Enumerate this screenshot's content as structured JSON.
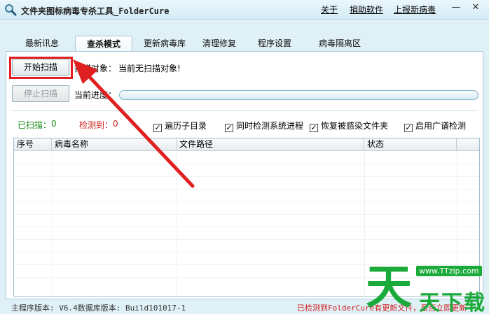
{
  "window": {
    "title": "文件夹图标病毒专杀工具_FolderCure",
    "links": [
      "关于",
      "捐助软件",
      "上报新病毒"
    ],
    "controls": {
      "minimize": "—",
      "close": "✕"
    }
  },
  "tabs": [
    {
      "label": "最新讯息",
      "active": false
    },
    {
      "label": "查杀模式",
      "active": true
    },
    {
      "label": "更新病毒库",
      "active": false
    },
    {
      "label": "清理修复",
      "active": false
    },
    {
      "label": "程序设置",
      "active": false
    },
    {
      "label": "病毒隔离区",
      "active": false
    }
  ],
  "scan": {
    "start_label": "开始扫描",
    "stop_label": "停止扫描",
    "target_label": "扫描对象：",
    "target_value": "当前无扫描对象!",
    "progress_label": "当前进度：",
    "progress": 0
  },
  "counters": {
    "scanned_label": "已扫描：",
    "scanned_value": "0",
    "detected_label": "检测到：",
    "detected_value": "0"
  },
  "options": [
    {
      "label": "遍历子目录",
      "checked": true
    },
    {
      "label": "同时检测系统进程",
      "checked": true
    },
    {
      "label": "恢复被感染文件夹",
      "checked": true
    },
    {
      "label": "启用广谱检测",
      "checked": true
    }
  ],
  "table": {
    "columns": [
      "序号",
      "病毒名称",
      "文件路径",
      "状态"
    ],
    "rows": []
  },
  "status": {
    "left": "主程序版本: V6.4数据库版本: Build101017-1",
    "right": "已检测到FolderCure有更新文件，是否立即更新"
  },
  "watermark": {
    "big": "天",
    "url": "www.TTzip.com",
    "sub": "天下载"
  },
  "colors": {
    "accent_green": "#1a8a1a",
    "alert_red": "#d02020",
    "watermark_green": "#1aaa3a"
  }
}
